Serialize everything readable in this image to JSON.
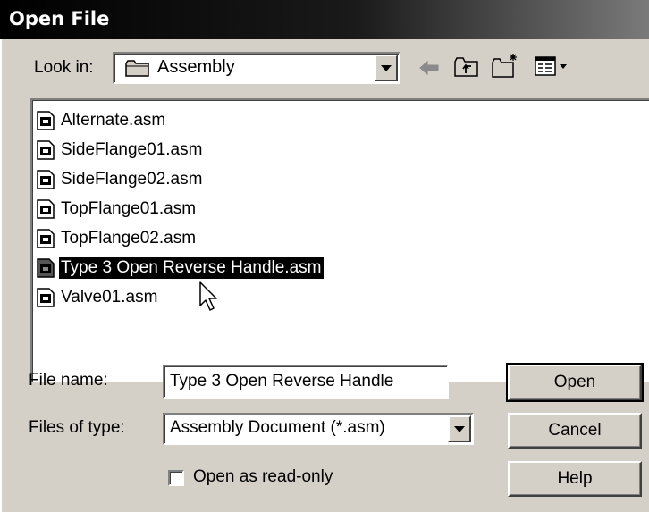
{
  "window": {
    "title": "Open File"
  },
  "look_in": {
    "label": "Look in:",
    "value": "Assembly",
    "icon": "folder-icon"
  },
  "toolbar": {
    "icons": [
      "back-arrow-icon",
      "up-one-level-icon",
      "create-new-folder-icon",
      "view-menu-icon"
    ]
  },
  "files": [
    {
      "name": "Alternate.asm",
      "selected": false
    },
    {
      "name": "SideFlange01.asm",
      "selected": false
    },
    {
      "name": "SideFlange02.asm",
      "selected": false
    },
    {
      "name": "TopFlange01.asm",
      "selected": false
    },
    {
      "name": "TopFlange02.asm",
      "selected": false
    },
    {
      "name": "Type 3 Open Reverse Handle.asm",
      "selected": true
    },
    {
      "name": "Valve01.asm",
      "selected": false
    }
  ],
  "file_name": {
    "label": "File name:",
    "value": "Type 3 Open Reverse Handle"
  },
  "file_type": {
    "label": "Files of type:",
    "value": "Assembly Document (*.asm)"
  },
  "read_only": {
    "label": "Open as read-only",
    "checked": false
  },
  "buttons": {
    "open": "Open",
    "cancel": "Cancel",
    "help": "Help"
  },
  "colors": {
    "selection": "#000000",
    "face": "#d4d0c8"
  }
}
